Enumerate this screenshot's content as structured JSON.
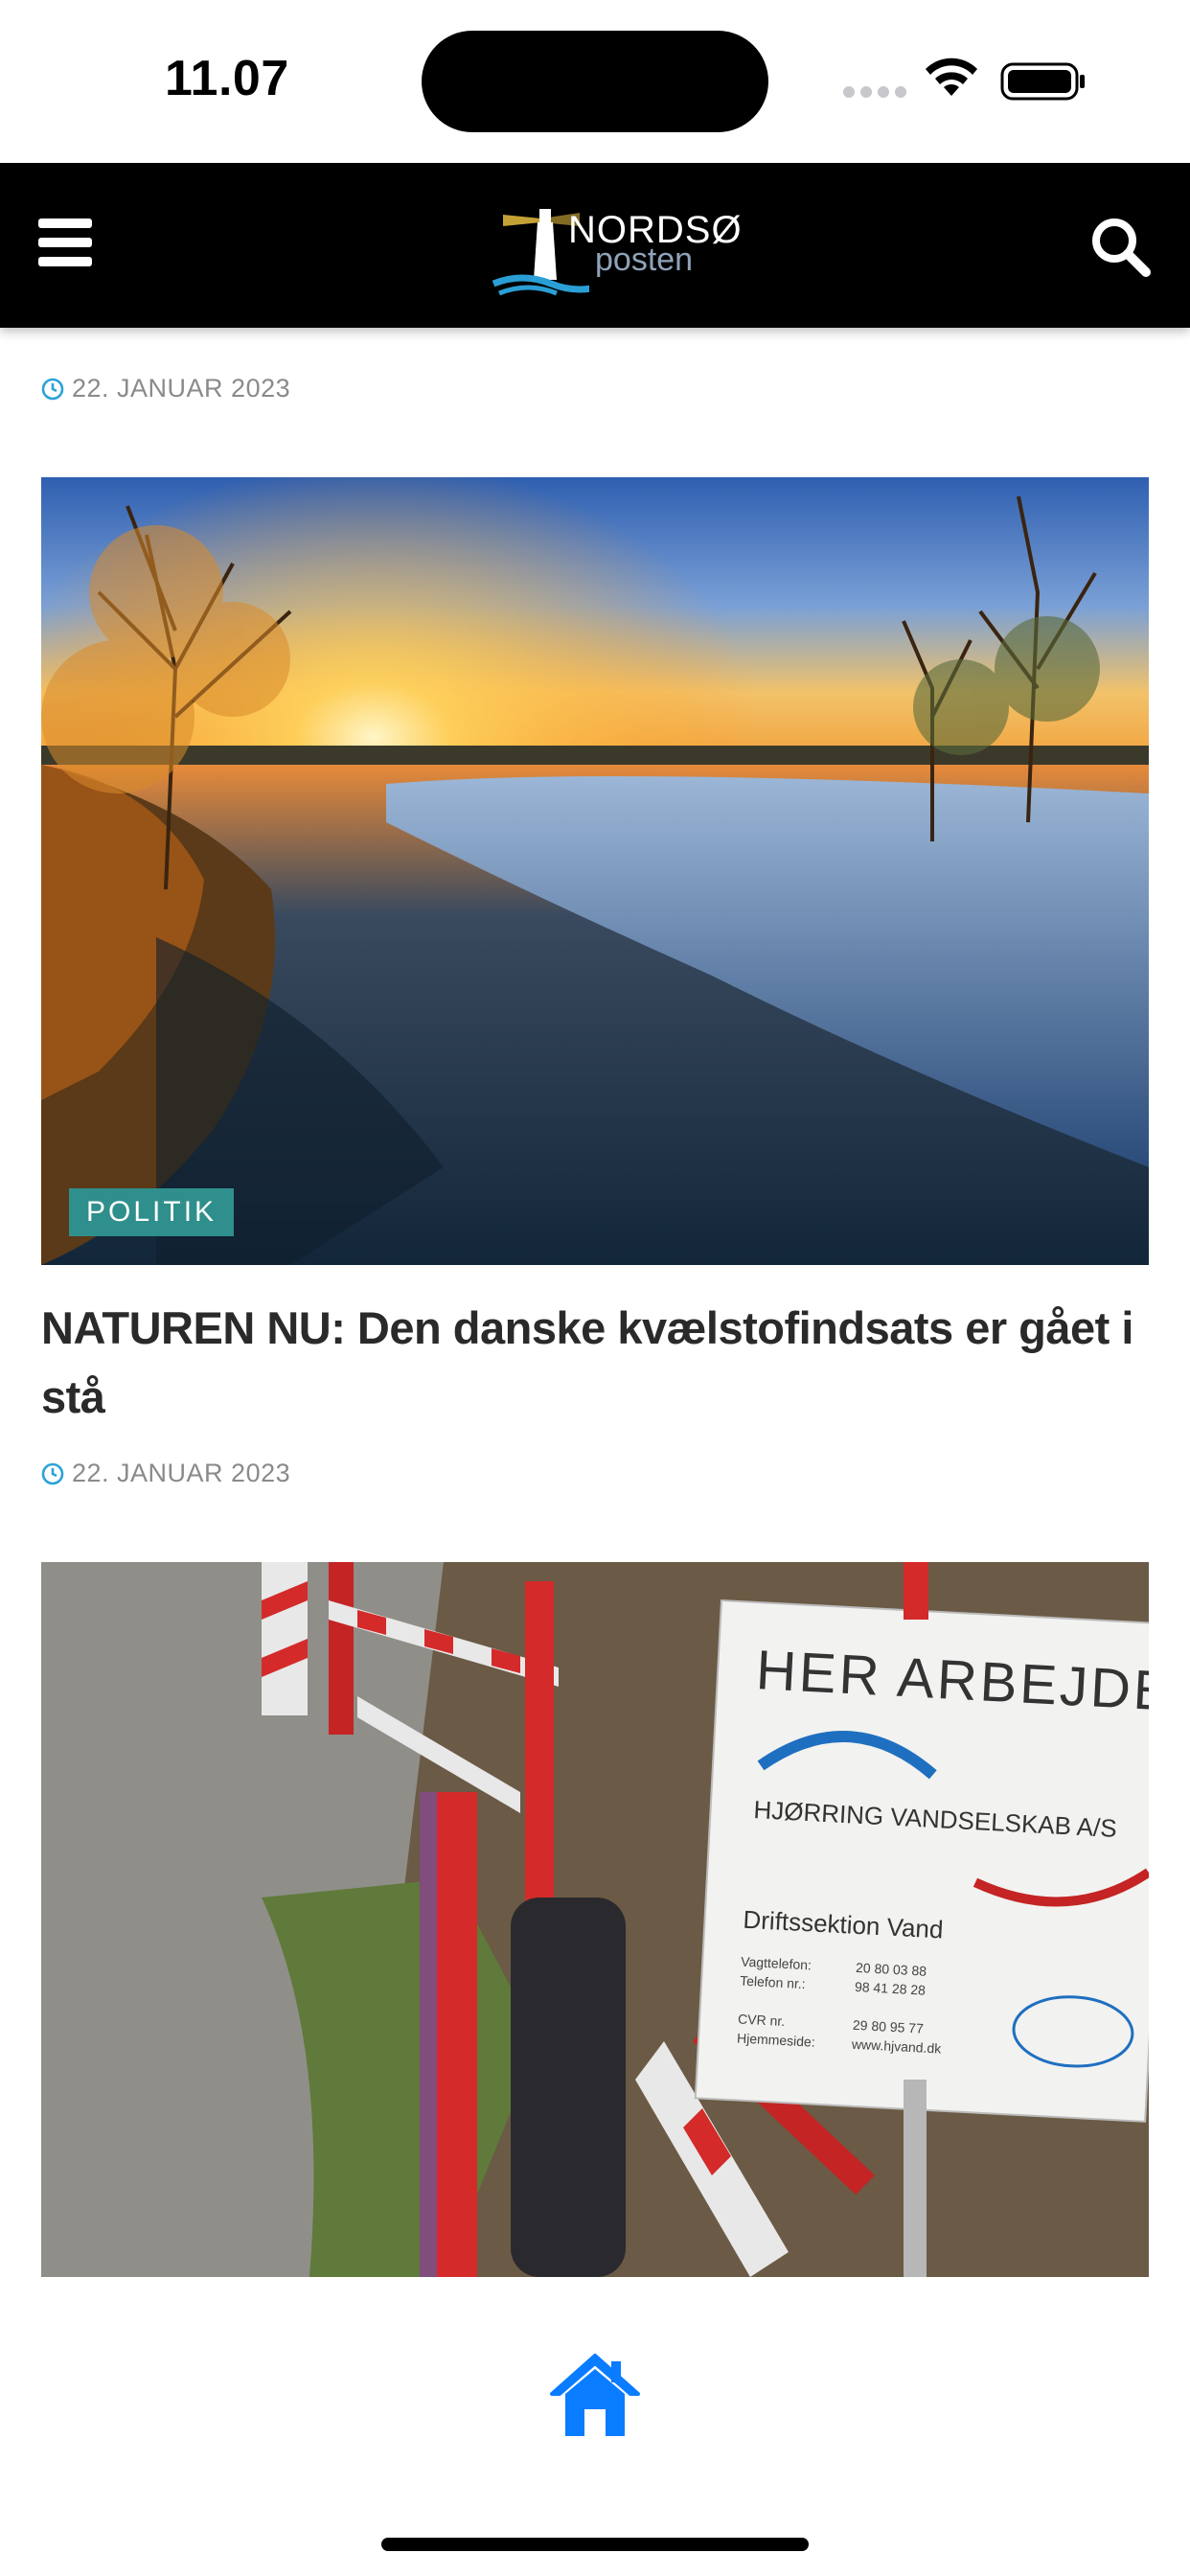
{
  "status_bar": {
    "time": "11.07"
  },
  "header": {
    "logo_top": "NORDSØ",
    "logo_bottom": "posten",
    "icons": [
      "menu-icon",
      "search-icon"
    ]
  },
  "articles": [
    {
      "date": "22. JANUAR 2023"
    },
    {
      "category": "POLITIK",
      "title": "NATUREN NU: Den danske kvælstofindsats er gået i stå",
      "date": "22. JANUAR 2023"
    },
    {
      "image_sign": {
        "heading": "HER ARBEJDE",
        "company": "HJØRRING VANDSELSKAB A/S",
        "department": "Driftssektion Vand",
        "lines": [
          "Vagttelefon:",
          "Telefon nr.:",
          "CVR nr.",
          "Hjemmeside:"
        ],
        "values": [
          "20 80 03 88",
          "98 41 28 28",
          "29 80 95 77",
          "www.hjvand.dk"
        ]
      }
    }
  ],
  "colors": {
    "header_bg": "#000000",
    "accent_teal": "#2f8f8c",
    "home_blue": "#0a7cff",
    "clock_blue": "#2aa3d8"
  },
  "bottom_nav": {
    "icon": "home-icon"
  }
}
